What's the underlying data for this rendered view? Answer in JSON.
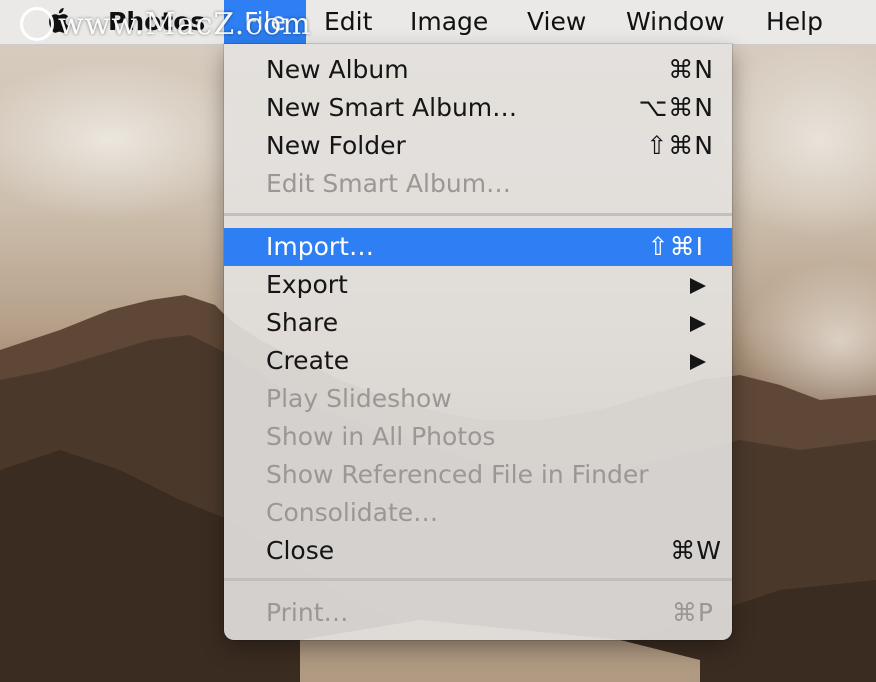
{
  "menubar": {
    "app_name": "Photos",
    "items": [
      "File",
      "Edit",
      "Image",
      "View",
      "Window",
      "Help"
    ],
    "active_item": "File"
  },
  "watermark": {
    "text": "www.MacZ.com"
  },
  "file_menu": {
    "group1": [
      {
        "label": "New Album",
        "shortcut": "⌘N",
        "enabled": true
      },
      {
        "label": "New Smart Album…",
        "shortcut": "⌥⌘N",
        "enabled": true
      },
      {
        "label": "New Folder",
        "shortcut": "⇧⌘N",
        "enabled": true
      },
      {
        "label": "Edit Smart Album…",
        "shortcut": "",
        "enabled": false
      }
    ],
    "group2": [
      {
        "label": "Import…",
        "shortcut": "⇧⌘I",
        "enabled": true,
        "highlighted": true
      },
      {
        "label": "Export",
        "submenu": true,
        "enabled": true
      },
      {
        "label": "Share",
        "submenu": true,
        "enabled": true
      },
      {
        "label": "Create",
        "submenu": true,
        "enabled": true
      },
      {
        "label": "Play Slideshow",
        "enabled": false
      },
      {
        "label": "Show in All Photos",
        "enabled": false
      },
      {
        "label": "Show Referenced File in Finder",
        "enabled": false
      },
      {
        "label": "Consolidate…",
        "enabled": false
      },
      {
        "label": "Close",
        "shortcut": "⌘W",
        "enabled": true
      }
    ],
    "group3": [
      {
        "label": "Print…",
        "shortcut": "⌘P",
        "enabled": false
      }
    ]
  },
  "colors": {
    "highlight": "#2d7ff3",
    "disabled_text": "#9a9794"
  }
}
